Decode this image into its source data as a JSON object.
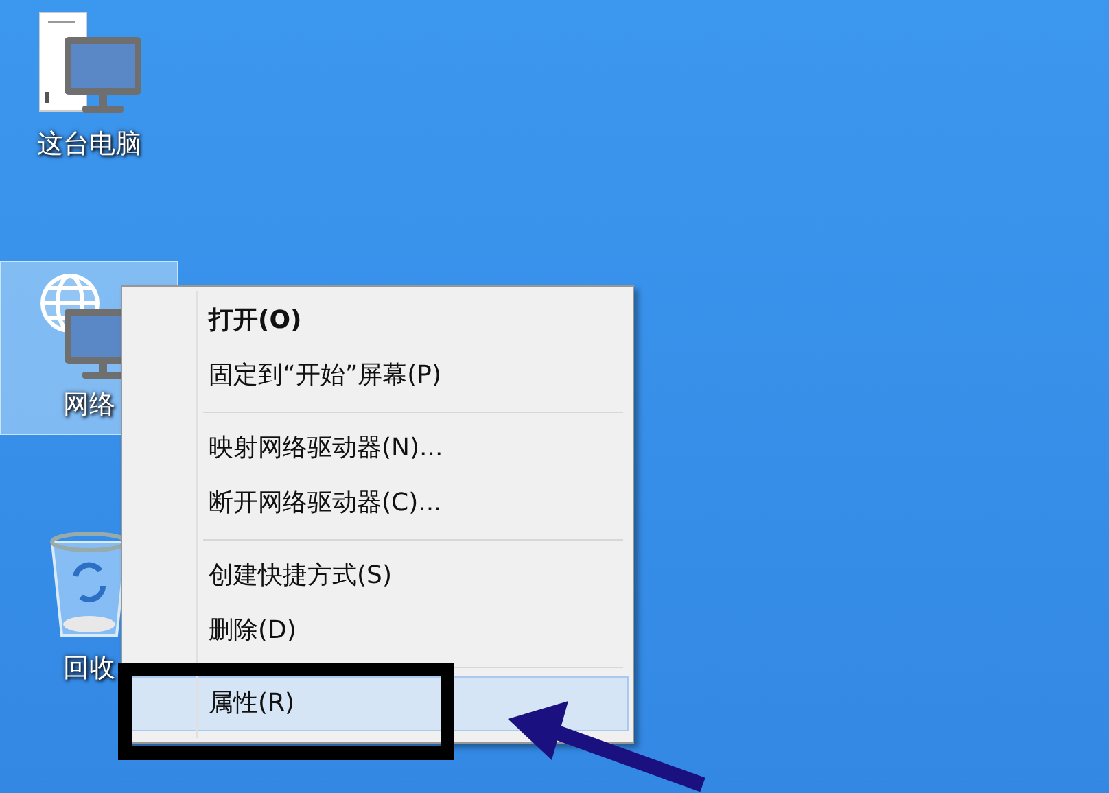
{
  "desktop_icons": [
    {
      "kind": "computer",
      "label": "这台电脑",
      "selected": false
    },
    {
      "kind": "network",
      "label": "网络",
      "selected": true
    },
    {
      "kind": "recycle-bin",
      "label": "回收",
      "selected": false
    }
  ],
  "context_menu": {
    "groups": [
      [
        {
          "label": "打开(O)",
          "default": true,
          "selected": false
        },
        {
          "label": "固定到“开始”屏幕(P)",
          "default": false,
          "selected": false
        }
      ],
      [
        {
          "label": "映射网络驱动器(N)...",
          "default": false,
          "selected": false
        },
        {
          "label": "断开网络驱动器(C)...",
          "default": false,
          "selected": false
        }
      ],
      [
        {
          "label": "创建快捷方式(S)",
          "default": false,
          "selected": false
        },
        {
          "label": "删除(D)",
          "default": false,
          "selected": false
        }
      ],
      [
        {
          "label": "属性(R)",
          "default": false,
          "selected": true
        }
      ]
    ]
  }
}
